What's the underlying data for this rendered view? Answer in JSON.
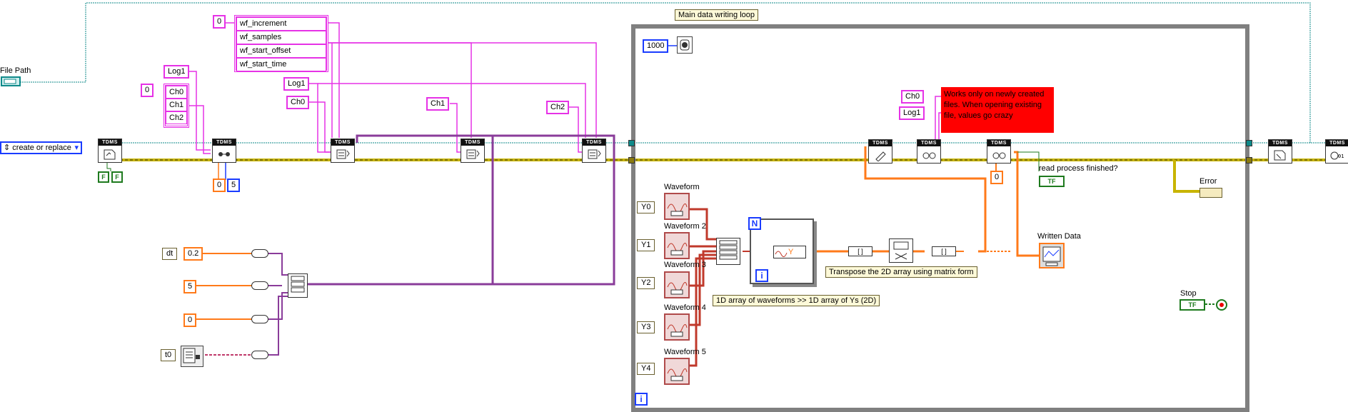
{
  "labels": {
    "file_path": "File Path",
    "loop_title": "Main data writing loop",
    "waveform0": "Waveform",
    "waveform2": "Waveform 2",
    "waveform3": "Waveform 3",
    "waveform4": "Waveform 4",
    "waveform5": "Waveform 5",
    "read_process": "read process finished?",
    "written_data": "Written Data",
    "error": "Error",
    "stop": "Stop",
    "comment_1d": "1D array of waveforms  >> 1D array of Ys (2D)",
    "comment_transpose": "Transpose the 2D array using matrix form",
    "note_red": "Works only on newly created files. When opening existing file, values go crazy"
  },
  "constants": {
    "create_or_replace": "create or replace",
    "index0_a": "0",
    "index0_b": "0",
    "wf_increment": "wf_increment",
    "wf_samples": "wf_samples",
    "wf_start_offset": "wf_start_offset",
    "wf_start_time": "wf_start_time",
    "log1_a": "Log1",
    "log1_b": "Log1",
    "log1_c": "Log1",
    "ch0_a": "Ch0",
    "ch1_a": "Ch1",
    "ch2_a": "Ch2",
    "ch0_b": "Ch0",
    "ch1_b": "Ch1",
    "ch2_b": "Ch2",
    "ch0_c": "Ch0",
    "zero_a": "0",
    "five_a": "5",
    "dt": "dt",
    "dt_val": "0.2",
    "five_b": "5",
    "zero_b": "0",
    "t0": "t0",
    "thousand": "1000",
    "zero_c": "0",
    "y0": "Y0",
    "y1": "Y1",
    "y2": "Y2",
    "y3": "Y3",
    "y4": "Y4",
    "tdms": "TDMS",
    "f1": "F",
    "f2": "F",
    "tf": "TF",
    "i_loop": "i",
    "i_for": "i",
    "n_for": "N",
    "y_unbundle": "Y",
    "arr_open": "[ ]",
    "arr_close": "[ ]"
  },
  "colors": {
    "pink": "#e632e6",
    "orange": "#ff7a1a",
    "blue": "#1a3cff",
    "teal": "#0e8a8a",
    "purple": "#8a3c9a",
    "error_wire": "#c8b400",
    "green": "#1e7a1e"
  }
}
